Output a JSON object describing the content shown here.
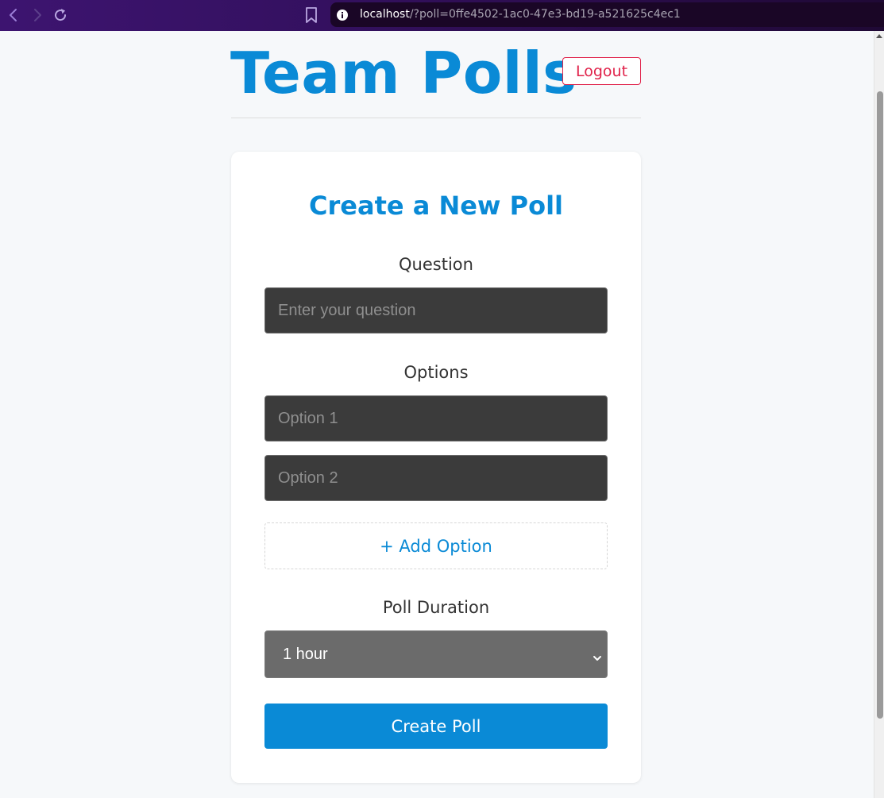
{
  "browser": {
    "url_host": "localhost",
    "url_path": "/?poll=0ffe4502-1ac0-47e3-bd19-a521625c4ec1"
  },
  "header": {
    "title": "Team Polls",
    "logout_label": "Logout"
  },
  "form": {
    "heading": "Create a New Poll",
    "question_label": "Question",
    "question_placeholder": "Enter your question",
    "options_label": "Options",
    "options": [
      {
        "placeholder": "Option 1"
      },
      {
        "placeholder": "Option 2"
      }
    ],
    "add_option_label": "+ Add Option",
    "duration_label": "Poll Duration",
    "duration_selected": "1 hour",
    "submit_label": "Create Poll"
  },
  "colors": {
    "accent": "#0a8ad6",
    "danger": "#e0224a",
    "input_bg": "#3b3b3b",
    "select_bg": "#6b6b6b",
    "page_bg": "#f6f8fa"
  }
}
